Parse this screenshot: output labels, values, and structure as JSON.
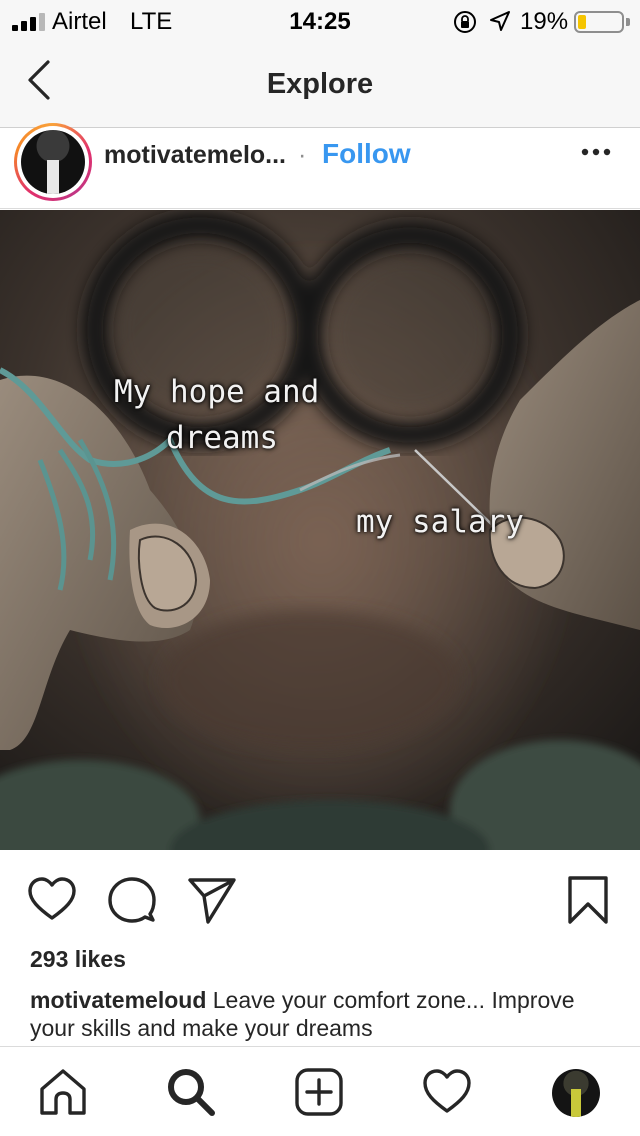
{
  "status_bar": {
    "carrier": "Airtel",
    "network": "LTE",
    "time": "14:25",
    "battery_percent": "19%",
    "battery_level": 0.19,
    "icons": [
      "signal-icon",
      "orientation-lock-icon",
      "location-icon",
      "battery-icon"
    ]
  },
  "nav": {
    "title": "Explore"
  },
  "post": {
    "username": "motivatemelo...",
    "separator": "·",
    "follow_label": "Follow",
    "image_text": {
      "line1": "My hope and",
      "line2": "dreams",
      "line3": "my salary"
    },
    "likes": "293 likes",
    "caption_user": "motivatemeloud",
    "caption_text": "Leave your comfort zone... Improve your skills and make your dreams"
  },
  "colors": {
    "accent": "#3897f0",
    "battery": "#f5c400",
    "text": "#262626"
  }
}
